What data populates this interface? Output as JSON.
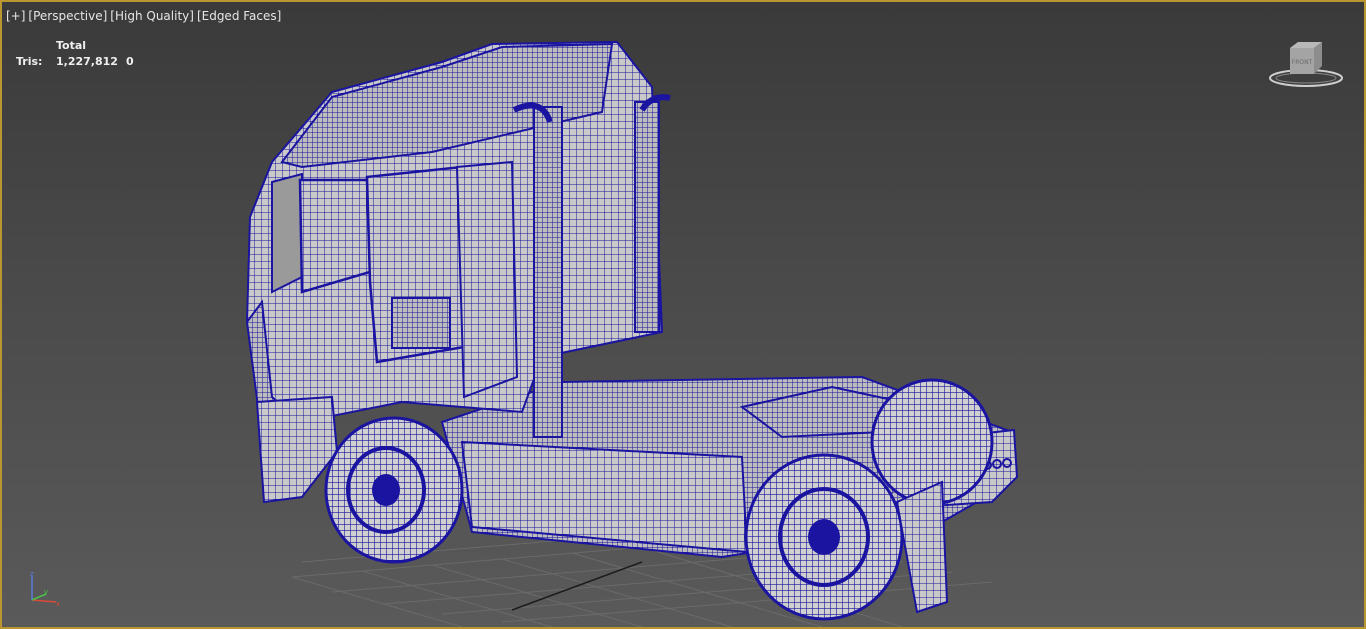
{
  "viewport": {
    "menu": [
      "[+]",
      "[Perspective]",
      "[High Quality]",
      "[Edged Faces]"
    ],
    "stats": {
      "header": "Total",
      "label": "Tris:",
      "total_value": "1,227,812",
      "selected_value": "0"
    },
    "viewcube_label": "FRONT"
  },
  "colors": {
    "border": "#b9962f",
    "wire": "#1a14a0",
    "surface": "#c9c9c9"
  }
}
